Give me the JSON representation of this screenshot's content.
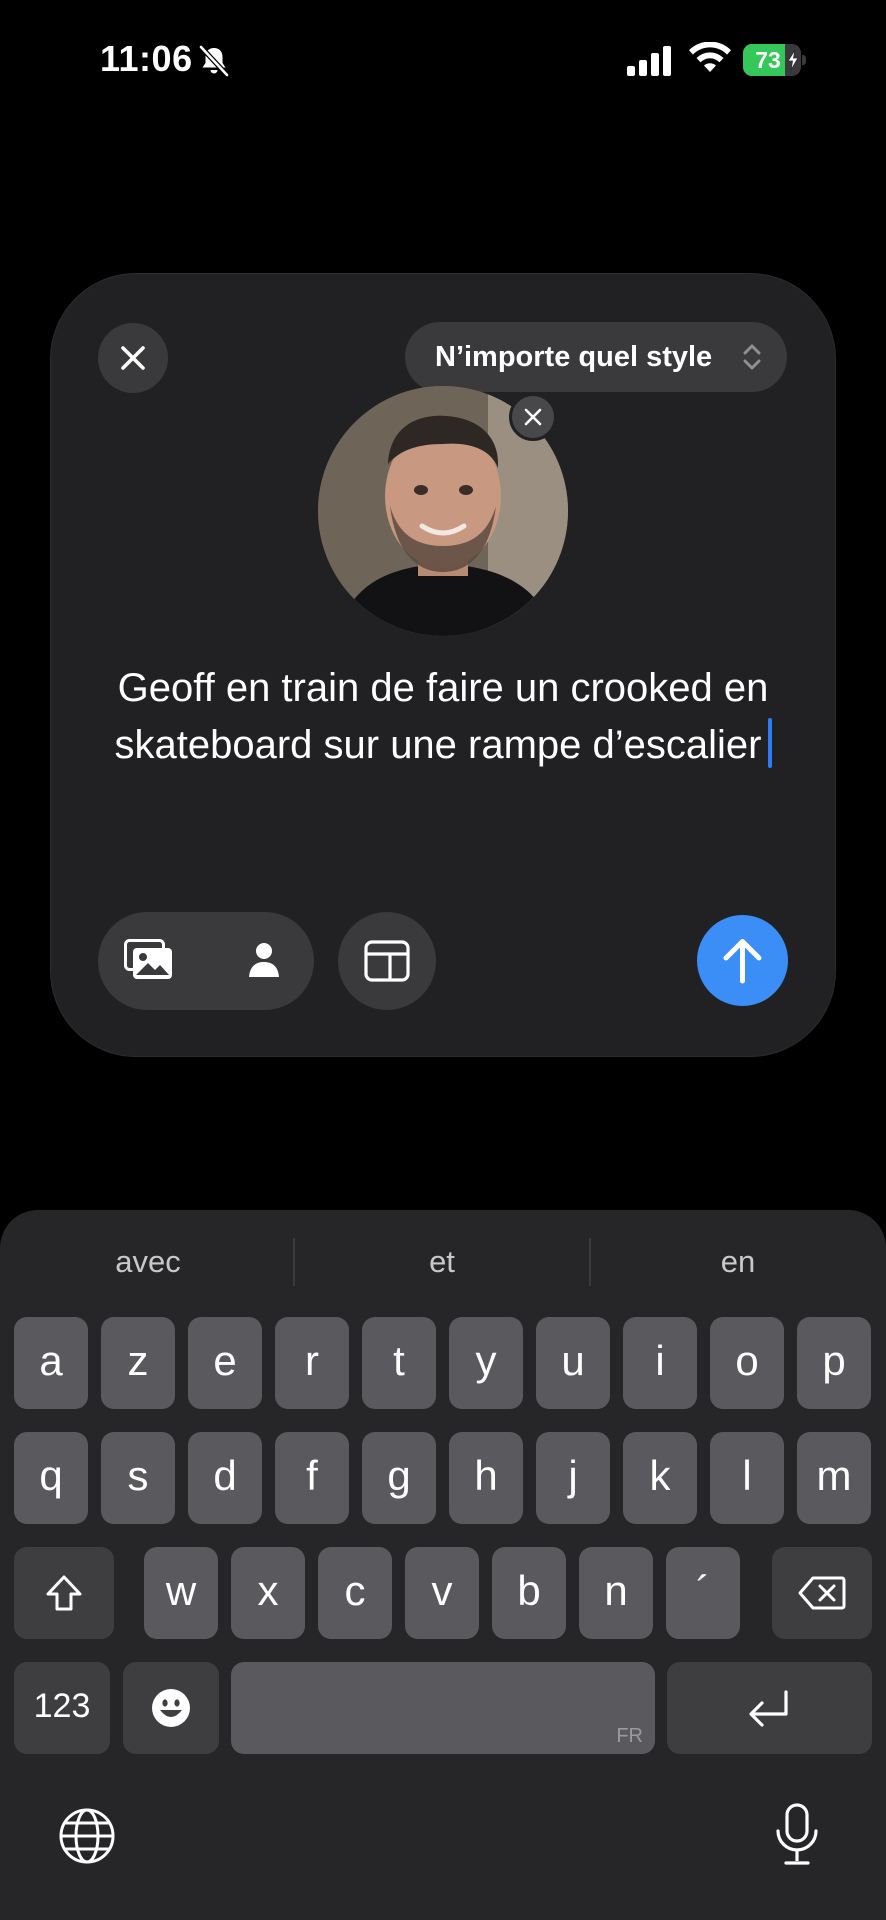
{
  "status_bar": {
    "time": "11:06",
    "battery_percent": 73,
    "icons": [
      "bell-slash-icon",
      "signal-icon",
      "wifi-icon",
      "battery-charging-icon"
    ]
  },
  "card": {
    "style_label": "N’importe quel style",
    "prompt_text": "Geoff en train de faire un crooked en skateboard sur une rampe d’escalier",
    "photo_subject": "portrait of a smiling man with a beard"
  },
  "keyboard": {
    "suggestions": [
      "avec",
      "et",
      "en"
    ],
    "row1": [
      "a",
      "z",
      "e",
      "r",
      "t",
      "y",
      "u",
      "i",
      "o",
      "p"
    ],
    "row2": [
      "q",
      "s",
      "d",
      "f",
      "g",
      "h",
      "j",
      "k",
      "l",
      "m"
    ],
    "row3": [
      "w",
      "x",
      "c",
      "v",
      "b",
      "n",
      "´"
    ],
    "numbers_label": "123",
    "language_tag": "FR"
  },
  "colors": {
    "accent": "#3a8ef6",
    "battery": "#34c759",
    "card": "#212123",
    "key": "#5a5a5e"
  }
}
